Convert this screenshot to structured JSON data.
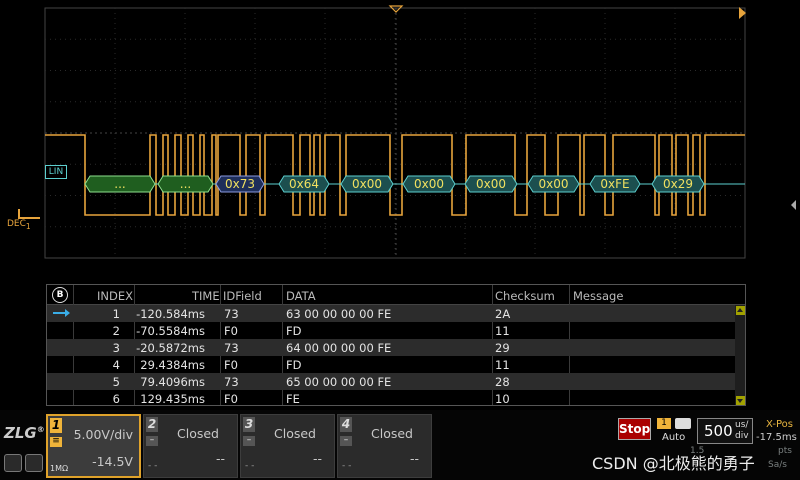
{
  "channel_labels": {
    "bus_tag": "LIN",
    "dec_tag": "DEC",
    "dec_sub": "1"
  },
  "decode_frames": [
    "...",
    "...",
    "0x73",
    "0x64",
    "0x00",
    "0x00",
    "0x00",
    "0x00",
    "0xFE",
    "0x29"
  ],
  "decode_table": {
    "columns": [
      "INDEX",
      "TIME",
      "IDField",
      "DATA",
      "Checksum",
      "Message"
    ],
    "rows": [
      {
        "index": "1",
        "time": "-120.584ms",
        "id": "73",
        "data": "63 00 00 00 00 FE",
        "checksum": "2A",
        "message": ""
      },
      {
        "index": "2",
        "time": "-70.5584ms",
        "id": "F0",
        "data": "FD",
        "checksum": "11",
        "message": ""
      },
      {
        "index": "3",
        "time": "-20.5872ms",
        "id": "73",
        "data": "64 00 00 00 00 FE",
        "checksum": "29",
        "message": ""
      },
      {
        "index": "4",
        "time": "29.4384ms",
        "id": "F0",
        "data": "FD",
        "checksum": "11",
        "message": ""
      },
      {
        "index": "5",
        "time": "79.4096ms",
        "id": "73",
        "data": "65 00 00 00 00 FE",
        "checksum": "28",
        "message": ""
      },
      {
        "index": "6",
        "time": "129.435ms",
        "id": "F0",
        "data": "FE",
        "checksum": "10",
        "message": ""
      }
    ],
    "bus_icon_label": "B"
  },
  "channels": [
    {
      "num": "1",
      "scale": "5.00V/div",
      "offset": "-14.5V",
      "coupling": "≡",
      "impedance": "1MΩ",
      "state": "active"
    },
    {
      "num": "2",
      "scale": "Closed",
      "offset": "--",
      "coupling": "–",
      "state": "closed"
    },
    {
      "num": "3",
      "scale": "Closed",
      "offset": "--",
      "coupling": "–",
      "state": "closed"
    },
    {
      "num": "4",
      "scale": "Closed",
      "offset": "--",
      "coupling": "–",
      "state": "closed"
    }
  ],
  "controls": {
    "logo": "ZLG",
    "run_state": "Stop",
    "trigger_source": "1",
    "trigger_mode": "Auto",
    "timebase_value": "500",
    "timebase_unit_top": "us/",
    "timebase_unit_bottom": "div",
    "xpos_label": "X-Pos",
    "xpos_value": "-17.5ms",
    "dim_values": [
      "1.5",
      "pts",
      "Sa/s"
    ]
  },
  "watermark": "CSDN @北极熊的勇子",
  "colors": {
    "trace": "#e7a43c",
    "decode_fill": "#1c4f4f",
    "decode_edge": "#5ccfcf",
    "grid": "#333",
    "accent": "#f0b43a",
    "stop": "#aa0000"
  }
}
